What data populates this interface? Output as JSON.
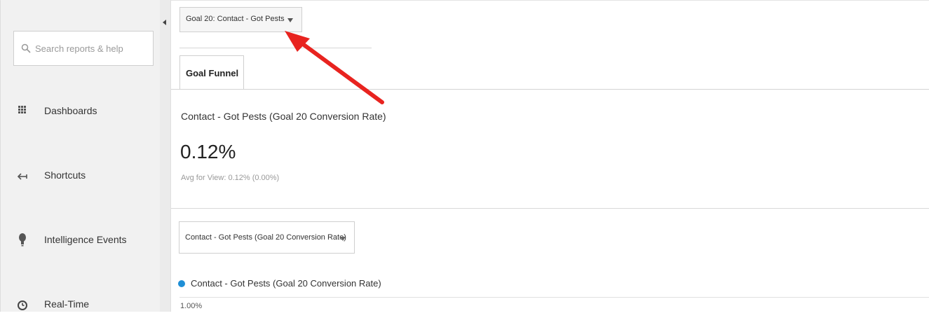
{
  "sidebar": {
    "search_placeholder": "Search reports & help",
    "items": [
      {
        "label": "Dashboards",
        "icon": "grid-icon"
      },
      {
        "label": "Shortcuts",
        "icon": "shortcut-arrow-icon"
      },
      {
        "label": "Intelligence Events",
        "icon": "lightbulb-icon"
      },
      {
        "label": "Real-Time",
        "icon": "clock-icon"
      }
    ]
  },
  "main": {
    "goal_selector_label": "Goal 20: Contact - Got Pests",
    "tab_label": "Goal Funnel",
    "metric_title": "Contact - Got Pests (Goal 20 Conversion Rate)",
    "metric_value": "0.12%",
    "metric_avg": "Avg for View: 0.12% (0.00%)",
    "metric_selector_label": "Contact - Got Pests (Goal 20 Conversion Rate)",
    "legend_label": "Contact - Got Pests (Goal 20 Conversion Rate)",
    "y_tick_top": "1.00%"
  },
  "colors": {
    "annotation_arrow": "#e8231f",
    "legend_dot": "#1f8fd6",
    "sidebar_bg": "#f1f1f1"
  }
}
